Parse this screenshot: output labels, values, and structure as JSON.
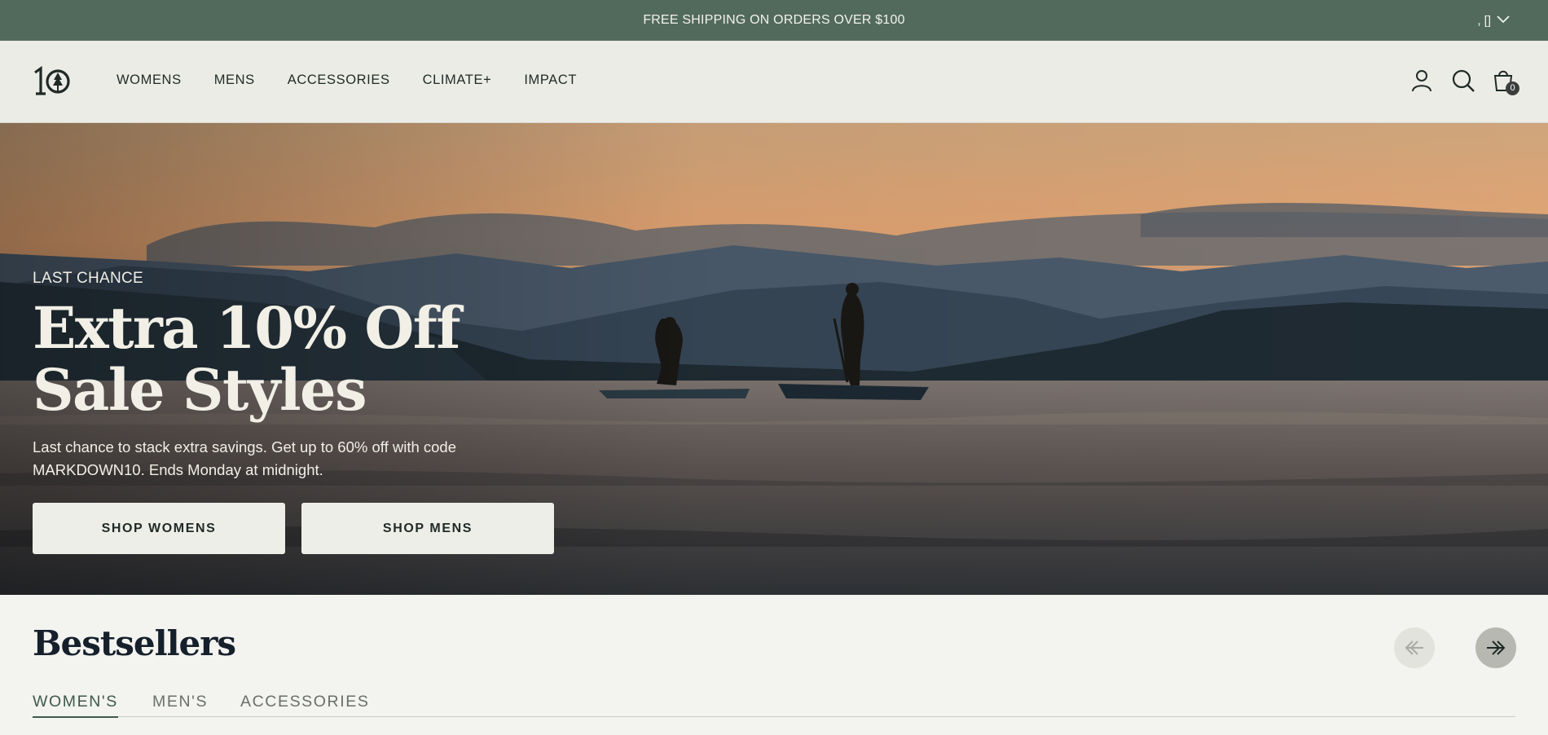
{
  "announcement": {
    "text": "FREE SHIPPING ON ORDERS OVER $100",
    "locale_label": ", []"
  },
  "header": {
    "logo_alt": "10",
    "nav": [
      "WOMENS",
      "MENS",
      "ACCESSORIES",
      "CLIMATE+",
      "IMPACT"
    ],
    "icons": [
      "account-icon",
      "search-icon",
      "cart-icon"
    ],
    "cart_count": "0"
  },
  "hero": {
    "eyebrow": "LAST CHANCE",
    "title": "Extra 10% Off Sale Styles",
    "description": "Last chance to stack extra savings. Get up to 60% off with code MARKDOWN10. Ends Monday at midnight.",
    "buttons": [
      "SHOP WOMENS",
      "SHOP MENS"
    ]
  },
  "bestsellers": {
    "title": "Bestsellers",
    "tabs": [
      "WOMEN'S",
      "MEN'S",
      "ACCESSORIES"
    ],
    "active_tab": "WOMEN'S"
  },
  "colors": {
    "announcement_bg": "#526a5b",
    "header_bg": "#ecece6",
    "page_bg": "#f3f3f0",
    "accent": "#3e5a4d"
  }
}
